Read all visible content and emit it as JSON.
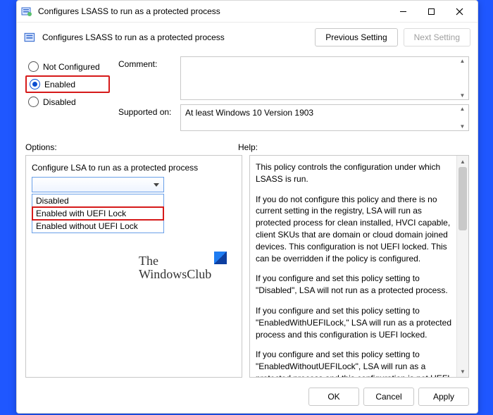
{
  "window": {
    "title": "Configures LSASS to run as a protected process",
    "subtitle": "Configures LSASS to run as a protected process"
  },
  "nav": {
    "prev": "Previous Setting",
    "next": "Next Setting"
  },
  "state": {
    "not_configured": "Not Configured",
    "enabled": "Enabled",
    "disabled": "Disabled",
    "selected": "enabled"
  },
  "meta": {
    "comment_label": "Comment:",
    "comment_value": "",
    "supported_label": "Supported on:",
    "supported_value": "At least Windows 10 Version 1903"
  },
  "sections": {
    "options_label": "Options:",
    "help_label": "Help:"
  },
  "options": {
    "lsa_label": "Configure LSA to run as a protected process",
    "dropdown": {
      "items": [
        "Disabled",
        "Enabled with UEFI Lock",
        "Enabled without UEFI Lock"
      ],
      "highlighted_index": 1
    }
  },
  "help": {
    "p1": "This policy controls the configuration under which LSASS is run.",
    "p2": "If you do not configure this policy and there is no current setting in the registry, LSA will run as protected process for clean installed, HVCI capable, client SKUs that are domain or cloud domain joined devices. This configuration is not UEFI locked. This can be overridden if the policy is configured.",
    "p3": "If you configure and set this policy setting to \"Disabled\", LSA will not run as a protected process.",
    "p4": "If you configure and set this policy setting to \"EnabledWithUEFILock,\" LSA will run as a protected process and this configuration is UEFI locked.",
    "p5": "If you configure and set this policy setting to \"EnabledWithoutUEFILock\", LSA will run as a protected process and this configuration is not UEFI locked."
  },
  "footer": {
    "ok": "OK",
    "cancel": "Cancel",
    "apply": "Apply"
  },
  "watermark": {
    "line1": "The",
    "line2": "WindowsClub"
  }
}
